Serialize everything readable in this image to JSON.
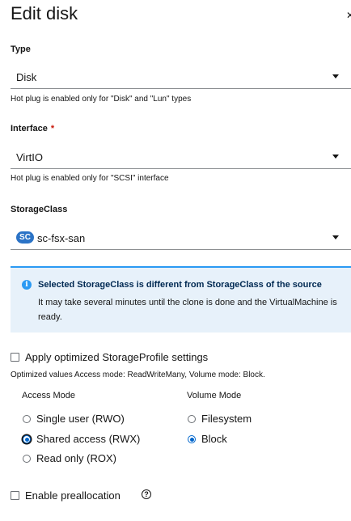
{
  "modal": {
    "title": "Edit disk",
    "close_icon": "close-icon"
  },
  "type_field": {
    "label": "Type",
    "value": "Disk",
    "helper": "Hot plug is enabled only for \"Disk\" and \"Lun\" types"
  },
  "interface_field": {
    "label": "Interface",
    "required_marker": "*",
    "value": "VirtIO",
    "helper": "Hot plug is enabled only for \"SCSI\" interface"
  },
  "storageclass_field": {
    "label": "StorageClass",
    "badge": "SC",
    "value": "sc-fsx-san"
  },
  "alert": {
    "icon": "info-circle-icon",
    "icon_glyph": "i",
    "title": "Selected StorageClass is different from StorageClass of the source",
    "body": "It may take several minutes until the clone is done and the VirtualMachine is ready."
  },
  "optimized": {
    "checkbox_label": "Apply optimized StorageProfile settings",
    "checked": false,
    "description": "Optimized values Access mode: ReadWriteMany, Volume mode: Block."
  },
  "access_mode": {
    "heading": "Access Mode",
    "options": [
      {
        "label": "Single user (RWO)",
        "selected": false
      },
      {
        "label": "Shared access (RWX)",
        "selected": true
      },
      {
        "label": "Read only (ROX)",
        "selected": false
      }
    ]
  },
  "volume_mode": {
    "heading": "Volume Mode",
    "options": [
      {
        "label": "Filesystem",
        "selected": false
      },
      {
        "label": "Block",
        "selected": true
      }
    ]
  },
  "preallocation": {
    "checkbox_label": "Enable preallocation",
    "checked": false,
    "help_glyph": "?"
  },
  "colors": {
    "accent": "#0066cc",
    "alert_bg": "#e7f1fa",
    "alert_border": "#2b9af3",
    "required": "#c9190b",
    "badge_bg": "#2b73c6"
  }
}
